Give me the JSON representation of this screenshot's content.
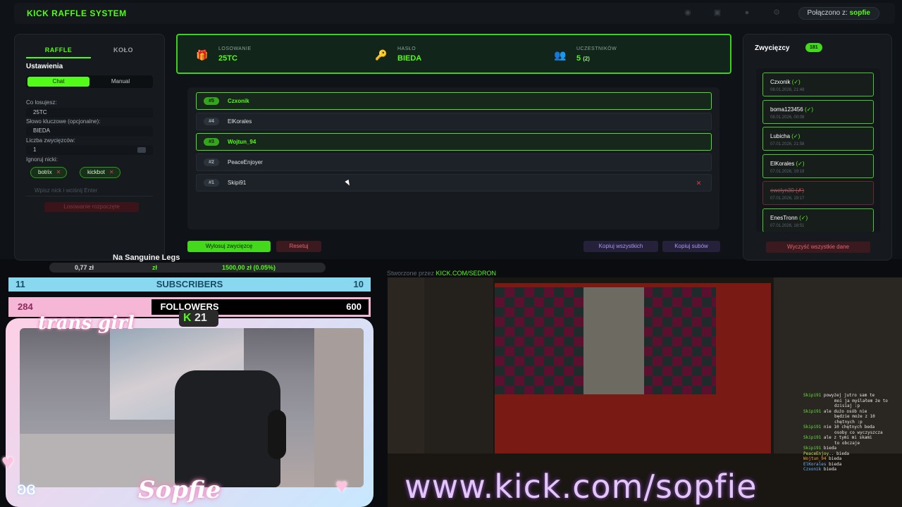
{
  "app": {
    "title": "KICK RAFFLE SYSTEM",
    "connection_label": "Połączono z: ",
    "connection_user": "sopfie",
    "icons": [
      "discord-icon",
      "twitch-icon",
      "github-icon",
      "settings-icon"
    ]
  },
  "settings": {
    "tabs": [
      "RAFFLE",
      "KOŁO"
    ],
    "active_tab": "RAFFLE",
    "section_title": "Ustawienia",
    "modes": [
      "Chat",
      "Manual"
    ],
    "active_mode": "Chat",
    "prize_label": "Co losujesz:",
    "prize_value": "25TC",
    "keyword_label": "Słowo kluczowe (opcjonalne):",
    "keyword_value": "BIEDA",
    "winners_label": "Liczba zwycięzców:",
    "winners_value": "1",
    "ignore_label": "Ignoruj nicki:",
    "ignored": [
      "botrix",
      "kickbot"
    ],
    "nick_placeholder": "Wpisz nick i wciśnij Enter",
    "start_button": "Losowanie rozpoczęte"
  },
  "info": {
    "draw_caption": "LOSOWANIE",
    "draw_value": "25TC",
    "password_caption": "HASŁO",
    "password_value": "BIEDA",
    "participants_caption": "UCZESTNIKÓW",
    "participants_value": "5",
    "participants_extra": "(2)"
  },
  "participants": [
    {
      "rank": "#5",
      "name": "Czxonik",
      "winner": true
    },
    {
      "rank": "#4",
      "name": "ElKorales",
      "winner": false
    },
    {
      "rank": "#3",
      "name": "Wojtun_94",
      "winner": true
    },
    {
      "rank": "#2",
      "name": "PeaceEnjoyer",
      "winner": false
    },
    {
      "rank": "#1",
      "name": "Skipi91",
      "winner": false
    }
  ],
  "actions": {
    "draw": "Wylosuj zwycięzcę",
    "reset": "Resetuj",
    "copy_all": "Kopiuj wszystkich",
    "copy_subs": "Kopiuj subów"
  },
  "winners_panel": {
    "title": "Zwycięzcy",
    "count": "181",
    "clear": "Wyczyść wszystkie dane",
    "items": [
      {
        "name": "Czxonik",
        "mark": "(✓)",
        "date": "08.01.2026, 21:48",
        "valid": true
      },
      {
        "name": "boma123456",
        "mark": "(✓)",
        "date": "08.01.2026, 00:08",
        "valid": true
      },
      {
        "name": "Lubicha",
        "mark": "(✓)",
        "date": "07.01.2026, 21:58",
        "valid": true
      },
      {
        "name": "ElKorales",
        "mark": "(✓)",
        "date": "07.01.2026, 19:19",
        "valid": true
      },
      {
        "name": "ewelyn30",
        "mark": "(✗)",
        "date": "07.01.2026, 19:17",
        "valid": false
      },
      {
        "name": "EnesTronn",
        "mark": "(✓)",
        "date": "07.01.2026, 18:51",
        "valid": true
      }
    ]
  },
  "overlay": {
    "song": "Na Sanguine Legs",
    "ticker_left": "0,77 zł",
    "ticker_mid": "zł",
    "ticker_right": "1500,00 zł (0.05%)",
    "subs_current": "11",
    "subs_label": "SUBSCRIBERS",
    "subs_goal": "10",
    "followers_current": "284",
    "followers_label": "FOLLOWERS",
    "followers_goal": "600",
    "badge_text": "trans girl",
    "kick_count": "21",
    "kick_letter": "K",
    "streamer_name": "Sopfie",
    "made_by_prefix": "Stworzone przez ",
    "made_by_link": "KICK.COM/SEDRON",
    "url": "www.kick.com/sopfie"
  },
  "chat": [
    {
      "user": "Skipi91",
      "text": "powyżej jutro sam te",
      "cls": ""
    },
    {
      "user": "",
      "text": "moi ja myślałem że to",
      "cls": ""
    },
    {
      "user": "",
      "text": "dzisiaj :p",
      "cls": ""
    },
    {
      "user": "Skipi91",
      "text": "ale dużo osób nie",
      "cls": ""
    },
    {
      "user": "",
      "text": "będzie może z 10",
      "cls": ""
    },
    {
      "user": "",
      "text": "chętnych :p",
      "cls": ""
    },
    {
      "user": "Skipi91",
      "text": "nie 10 chętnych beda",
      "cls": ""
    },
    {
      "user": "",
      "text": "osoby co wyczyszcza",
      "cls": ""
    },
    {
      "user": "Skipi91",
      "text": "ale z tymi mi skami",
      "cls": ""
    },
    {
      "user": "",
      "text": "to obczaje",
      "cls": ""
    },
    {
      "user": "Skipi91",
      "text": "bieda",
      "cls": ""
    },
    {
      "user": "PeaceEnjoy..",
      "text": "bieda",
      "cls": "peace"
    },
    {
      "user": "Wojtun_94",
      "text": "bieda",
      "cls": "woj"
    },
    {
      "user": "ElKorales",
      "text": "bieda",
      "cls": "blue"
    },
    {
      "user": "Czxonik",
      "text": "bieda",
      "cls": "blue"
    }
  ]
}
